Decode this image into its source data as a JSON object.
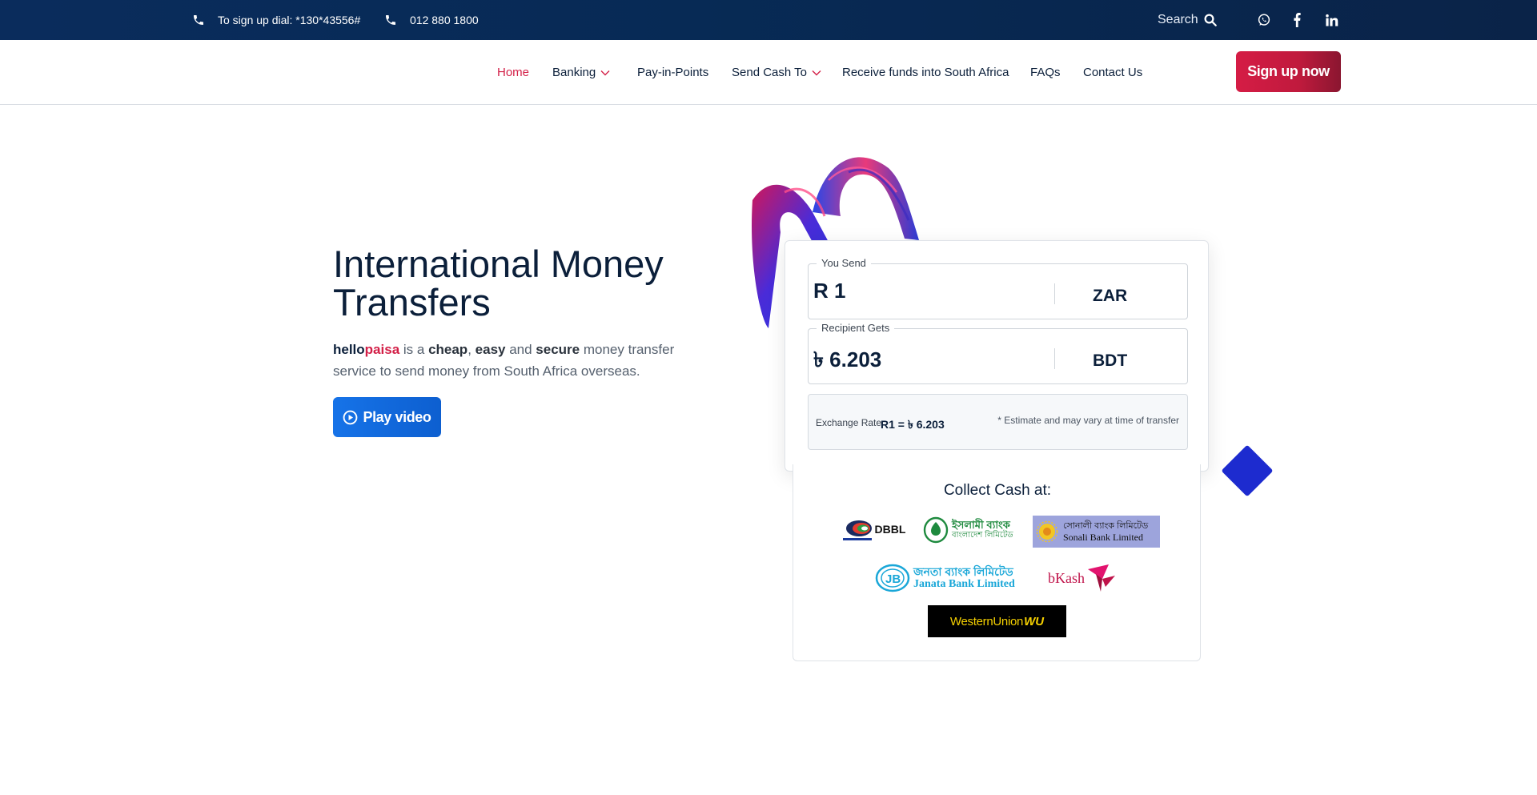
{
  "topbar": {
    "signup_dial": "To sign up dial: *130*43556#",
    "phone": "012 880 1800",
    "search_label": "Search"
  },
  "nav": {
    "items": [
      {
        "label": "Home",
        "active": true
      },
      {
        "label": "Banking",
        "dropdown": true
      },
      {
        "label": "Pay-in-Points"
      },
      {
        "label": "Send Cash To",
        "dropdown": true
      },
      {
        "label": "Receive funds into South Africa"
      },
      {
        "label": "FAQs"
      },
      {
        "label": "Contact Us"
      }
    ],
    "signup_button": "Sign up now"
  },
  "hero": {
    "title": "International Money Transfers",
    "brand_part1": "hello",
    "brand_part2": "paisa",
    "desc_1": " is a ",
    "desc_cheap": "cheap",
    "desc_2": ", ",
    "desc_easy": "easy",
    "desc_3": " and ",
    "desc_secure": "secure",
    "desc_4": " money transfer service to send money from South Africa overseas.",
    "play_button": "Play video"
  },
  "calculator": {
    "send_legend": "You Send",
    "send_amount": "R 1",
    "send_currency": "ZAR",
    "receive_legend": "Recipient Gets",
    "receive_amount": "৳ 6.203",
    "receive_currency": "BDT",
    "rate_label": "Exchange Rate",
    "rate_value": "R1 = ৳ 6.203",
    "rate_note": "* Estimate and may vary at time of transfer"
  },
  "collect": {
    "title": "Collect Cash at:",
    "logos": {
      "dbbl": "DBBL",
      "islami_line1": "ইসলামী ব্যাংক",
      "islami_line2": "বাংলাদেশ লিমিটেড",
      "sonali_line1": "সোনালী ব্যাংক লিমিটেড",
      "sonali_line2": "Sonali Bank Limited",
      "janata_line1": "জনতা ব্যাংক লিমিটেড",
      "janata_line2": "Janata Bank Limited",
      "bkash": "bKash",
      "wu_text": "WesternUnion",
      "wu_mark": "WU"
    }
  },
  "colors": {
    "topbar": "#0a2c5c",
    "accent_red": "#d31f47",
    "accent_blue": "#1673e8",
    "navy_text": "#0b1f3a"
  }
}
